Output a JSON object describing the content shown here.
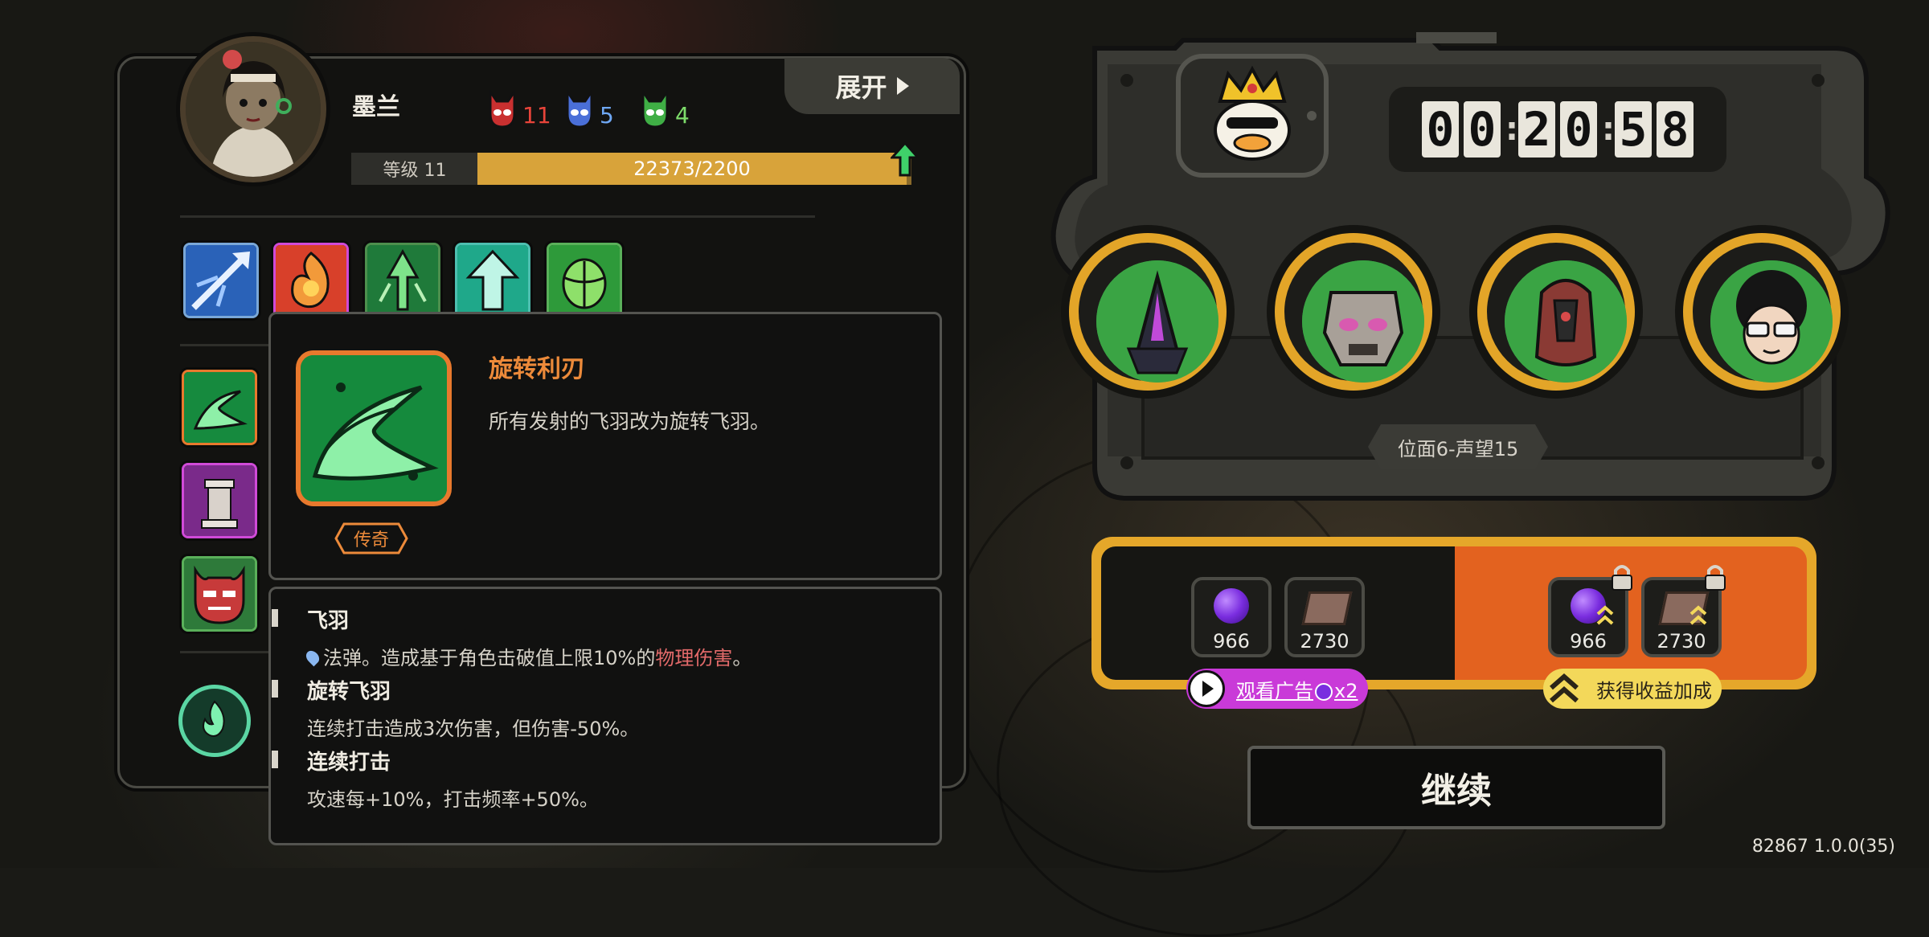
{
  "character": {
    "name": "墨兰",
    "stats": [
      {
        "icon": "red-mask-icon",
        "value": "11",
        "color": "#e8443a"
      },
      {
        "icon": "blue-mask-icon",
        "value": "5",
        "color": "#6fa8f5"
      },
      {
        "icon": "green-mask-icon",
        "value": "4",
        "color": "#7ddc6a"
      }
    ],
    "level_label": "等级 11",
    "xp_text": "22373/2200",
    "expand_label": "展开"
  },
  "skills_row": [
    "ice-arrow-icon",
    "fire-spirit-icon",
    "green-arrows-icon",
    "tree-arrow-icon",
    "green-beetle-icon"
  ],
  "left_column": [
    "green-swirl-icon",
    "pillar-icon",
    "demon-mask-icon"
  ],
  "tooltip": {
    "icon": "spinning-blade-icon",
    "title": "旋转利刃",
    "description": "所有发射的飞羽改为旋转飞羽。",
    "rarity": "传奇",
    "keywords": [
      {
        "title": "飞羽",
        "desc_parts": [
          "法弹。造成基于角色击破值上限10%的",
          "物理伤害",
          "。"
        ]
      },
      {
        "title": "旋转飞羽",
        "desc": "连续打击造成3次伤害，但伤害-50%。"
      },
      {
        "title": "连续打击",
        "desc": "攻速每+10%，打击频率+50%。"
      }
    ]
  },
  "timer": {
    "digits": [
      "0",
      "0",
      "2",
      "0",
      "5",
      "8"
    ]
  },
  "boss_slots": [
    "dark-beak-icon",
    "armored-skull-icon",
    "hooded-warrior-icon",
    "afro-glasses-icon"
  ],
  "stage_label": "位面6-声望15",
  "rewards": {
    "base": [
      {
        "icon": "purple-orb-icon",
        "value": "966"
      },
      {
        "icon": "book-icon",
        "value": "2730"
      }
    ],
    "boosted": [
      {
        "icon": "purple-orb-icon",
        "value": "966"
      },
      {
        "icon": "book-icon",
        "value": "2730"
      }
    ],
    "ad_button_label": "观看广告",
    "ad_multiplier": "x2",
    "boost_button_label": "获得收益加成"
  },
  "continue_label": "继续",
  "version": "82867 1.0.0(35)",
  "colors": {
    "accent_gold": "#e5a72a",
    "accent_orange": "#e3621f",
    "legend_orange": "#ec8a3a",
    "ad_purple": "#c93ad8"
  }
}
